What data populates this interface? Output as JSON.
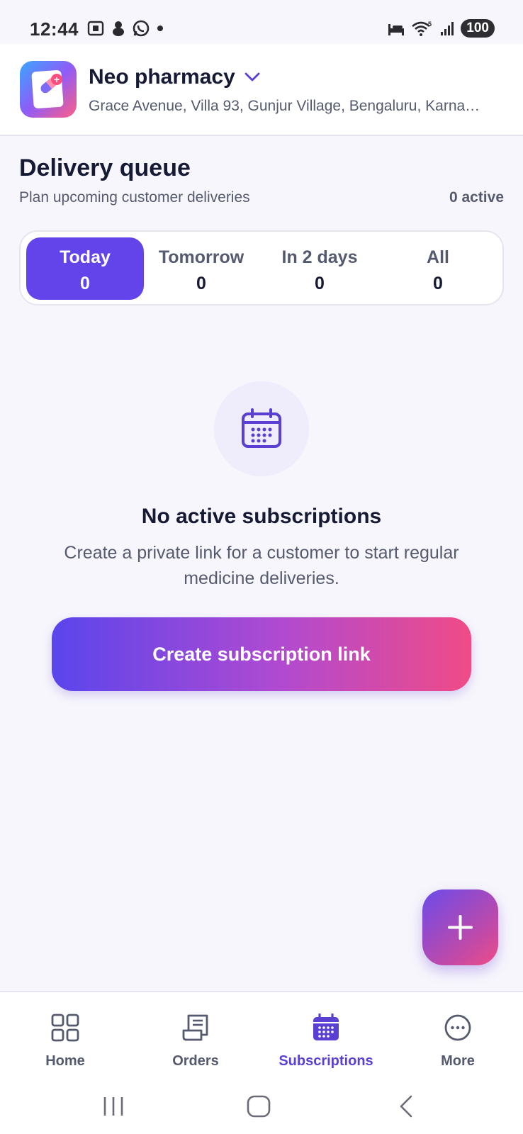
{
  "status_bar": {
    "time": "12:44",
    "battery": "100",
    "left_icons": [
      "screenshot-icon",
      "notification-icon",
      "whatsapp-icon",
      "dot-icon"
    ],
    "right_icons": [
      "sleep-mode-icon",
      "wifi-icon",
      "signal-icon"
    ]
  },
  "header": {
    "store_name": "Neo pharmacy",
    "address": "Grace Avenue, Villa 93, Gunjur Village, Bengaluru, Karna…"
  },
  "section": {
    "title": "Delivery queue",
    "subtitle": "Plan upcoming customer deliveries",
    "active_count": "0 active"
  },
  "tabs": [
    {
      "label": "Today",
      "count": "0"
    },
    {
      "label": "Tomorrow",
      "count": "0"
    },
    {
      "label": "In 2 days",
      "count": "0"
    },
    {
      "label": "All",
      "count": "0"
    }
  ],
  "empty_state": {
    "title": "No active subscriptions",
    "description": "Create a private link for a customer to start regular medicine deliveries.",
    "button_label": "Create subscription link"
  },
  "bottom_nav": {
    "items": [
      {
        "label": "Home",
        "icon": "grid-icon"
      },
      {
        "label": "Orders",
        "icon": "receipt-icon"
      },
      {
        "label": "Subscriptions",
        "icon": "calendar-icon"
      },
      {
        "label": "More",
        "icon": "more-icon"
      }
    ]
  },
  "colors": {
    "accent": "#6244ea",
    "background": "#f7f6fc",
    "text": "#161a35",
    "muted_text": "#555a6e",
    "gradient_start": "#5a45ec",
    "gradient_end": "#f04b86"
  }
}
